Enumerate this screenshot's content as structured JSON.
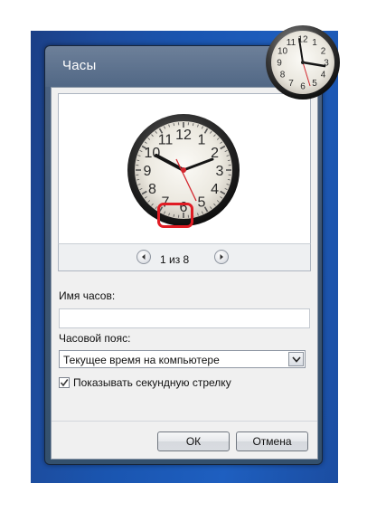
{
  "window": {
    "title": "Часы"
  },
  "preview": {
    "pager_text": "1 из 8",
    "clock_numerals": [
      "12",
      "1",
      "2",
      "3",
      "4",
      "5",
      "6",
      "7",
      "8",
      "9",
      "10",
      "11"
    ]
  },
  "form": {
    "clock_name_label": "Имя часов:",
    "clock_name_value": "",
    "timezone_label": "Часовой пояс:",
    "timezone_selected": "Текущее время на компьютере",
    "show_seconds_label": "Показывать секундную стрелку",
    "show_seconds_checked": true
  },
  "buttons": {
    "ok": "ОК",
    "cancel": "Отмена"
  },
  "colors": {
    "highlight": "#e01c24",
    "second_hand": "#d3262e"
  }
}
